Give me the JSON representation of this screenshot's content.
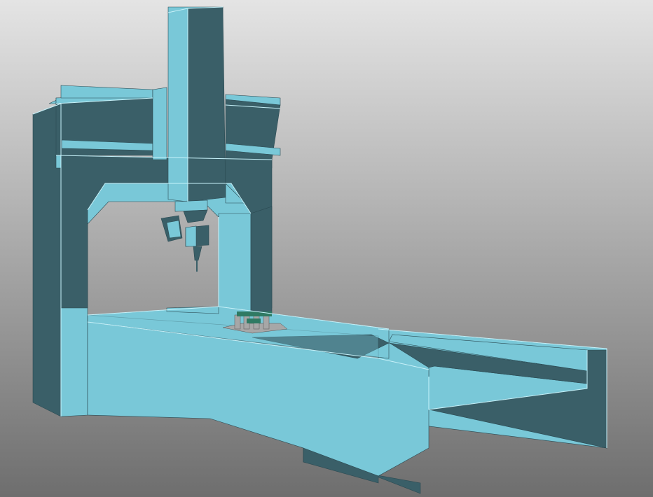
{
  "scene": {
    "background_top": "#e4e4e4",
    "background_bottom": "#6e6e6e",
    "light": "#79c8d8",
    "dark": "#3a5f68",
    "edge": "#c8f3fb",
    "outline": "#2b4a52",
    "part_green": "#2f7a63",
    "part_metal": "#a7a7a7"
  }
}
